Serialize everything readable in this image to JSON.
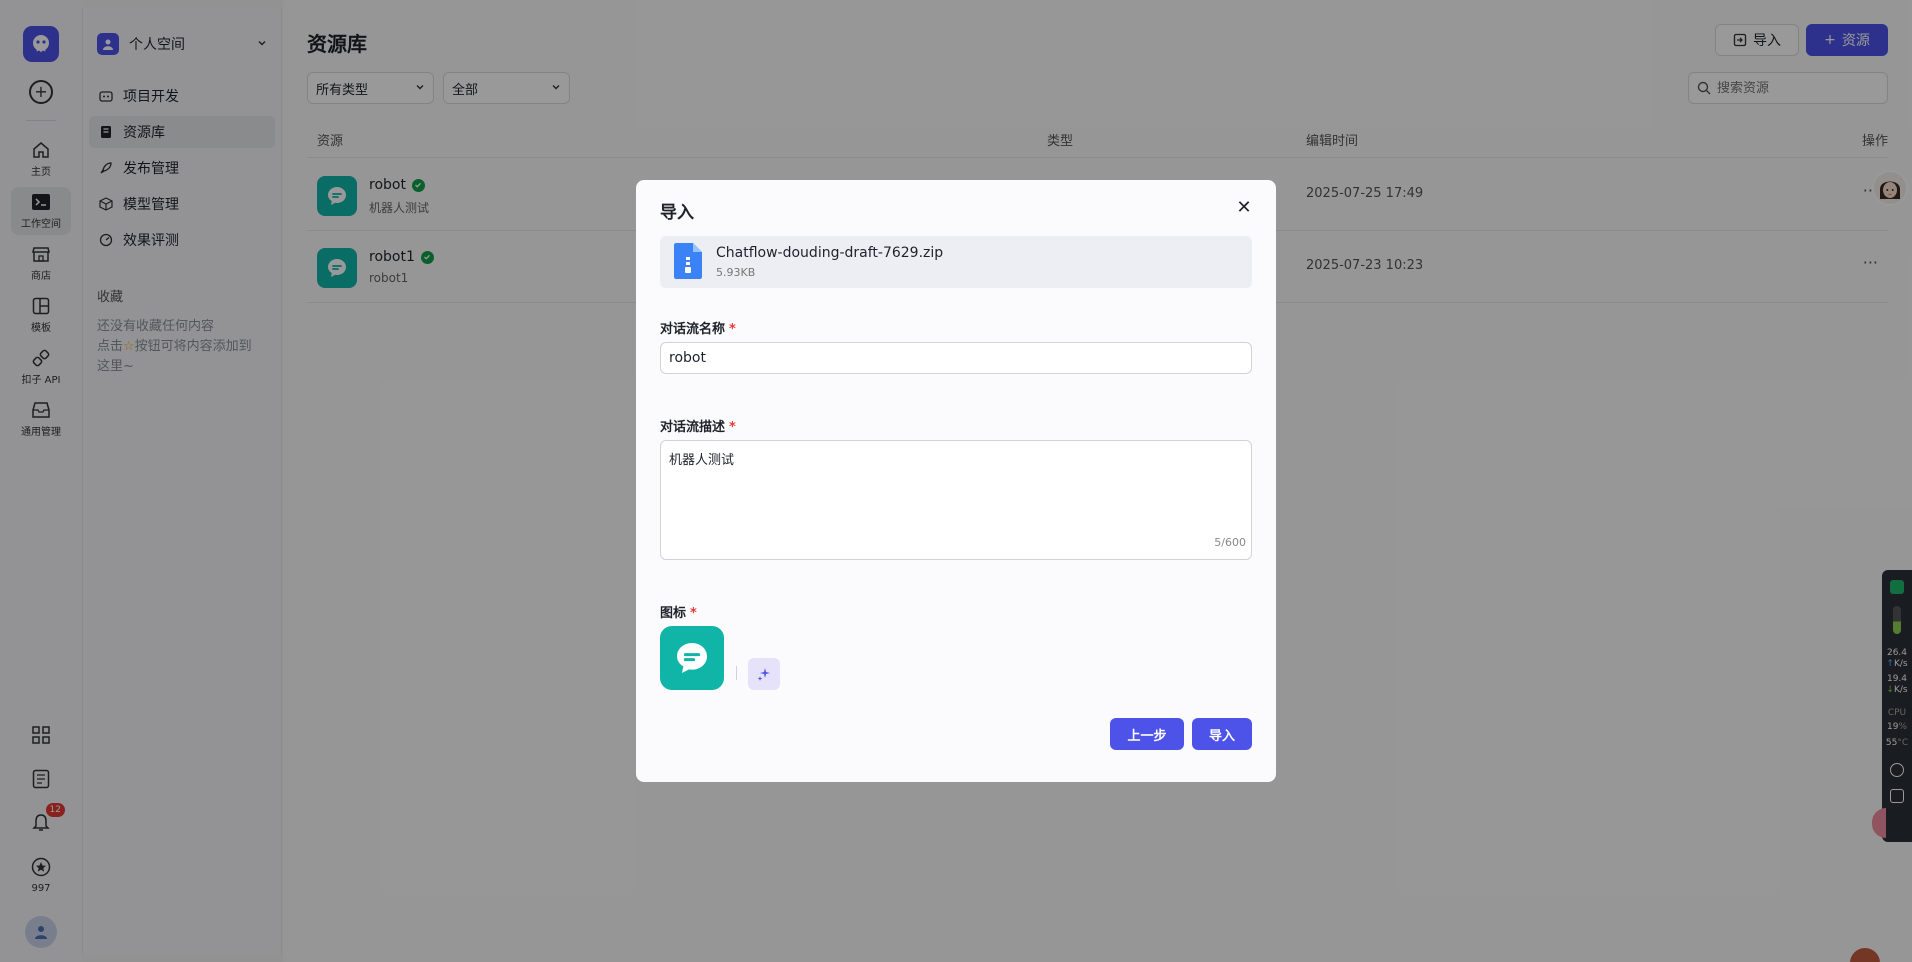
{
  "rail": {
    "items": [
      {
        "label": "主页",
        "icon": "home-icon"
      },
      {
        "label": "工作空间",
        "icon": "terminal-icon"
      },
      {
        "label": "商店",
        "icon": "store-icon"
      },
      {
        "label": "模板",
        "icon": "template-icon"
      },
      {
        "label": "扣子 API",
        "icon": "api-icon"
      },
      {
        "label": "通用管理",
        "icon": "inbox-icon"
      }
    ],
    "notification_count": "12",
    "star_count": "997"
  },
  "sidebar": {
    "space_name": "个人空间",
    "menu": [
      {
        "label": "项目开发",
        "icon": "robot-icon"
      },
      {
        "label": "资源库",
        "icon": "book-icon"
      },
      {
        "label": "发布管理",
        "icon": "rocket-icon"
      },
      {
        "label": "模型管理",
        "icon": "cube-icon"
      },
      {
        "label": "效果评测",
        "icon": "gauge-icon"
      }
    ],
    "favorites_title": "收藏",
    "favorites_empty_line1": "还没有收藏任何内容",
    "favorites_empty_line2a": "点击",
    "favorites_empty_line2b": "按钮可将内容添加到",
    "favorites_empty_line3": "这里~"
  },
  "main": {
    "title": "资源库",
    "import_button": "导入",
    "add_resource_button": "资源",
    "filter_type": "所有类型",
    "filter_scope": "全部",
    "search_placeholder": "搜索资源",
    "columns": {
      "resource": "资源",
      "type": "类型",
      "edit_time": "编辑时间",
      "actions": "操作"
    },
    "rows": [
      {
        "name": "robot",
        "desc": "机器人测试",
        "time": "2025-07-25 17:49"
      },
      {
        "name": "robot1",
        "desc": "robot1",
        "time": "2025-07-23 10:23"
      }
    ]
  },
  "modal": {
    "title": "导入",
    "file_name": "Chatflow-douding-draft-7629.zip",
    "file_size": "5.93KB",
    "name_label": "对话流名称",
    "name_value": "robot",
    "desc_label": "对话流描述",
    "desc_value": "机器人测试",
    "desc_count": "5/600",
    "icon_label": "图标",
    "required_mark": "*",
    "prev_button": "上一步",
    "import_button": "导入"
  },
  "monitor": {
    "upload": "26.4",
    "upload_unit": "K/s",
    "download": "19.4",
    "download_unit": "K/s",
    "cpu_label": "CPU",
    "cpu_value": "19",
    "cpu_unit": "%",
    "temp_value": "55",
    "temp_unit": "°C"
  },
  "colors": {
    "brand": "#4d53e8",
    "teal": "#10b5a8",
    "required": "#e53935",
    "verified": "#12a04a"
  }
}
